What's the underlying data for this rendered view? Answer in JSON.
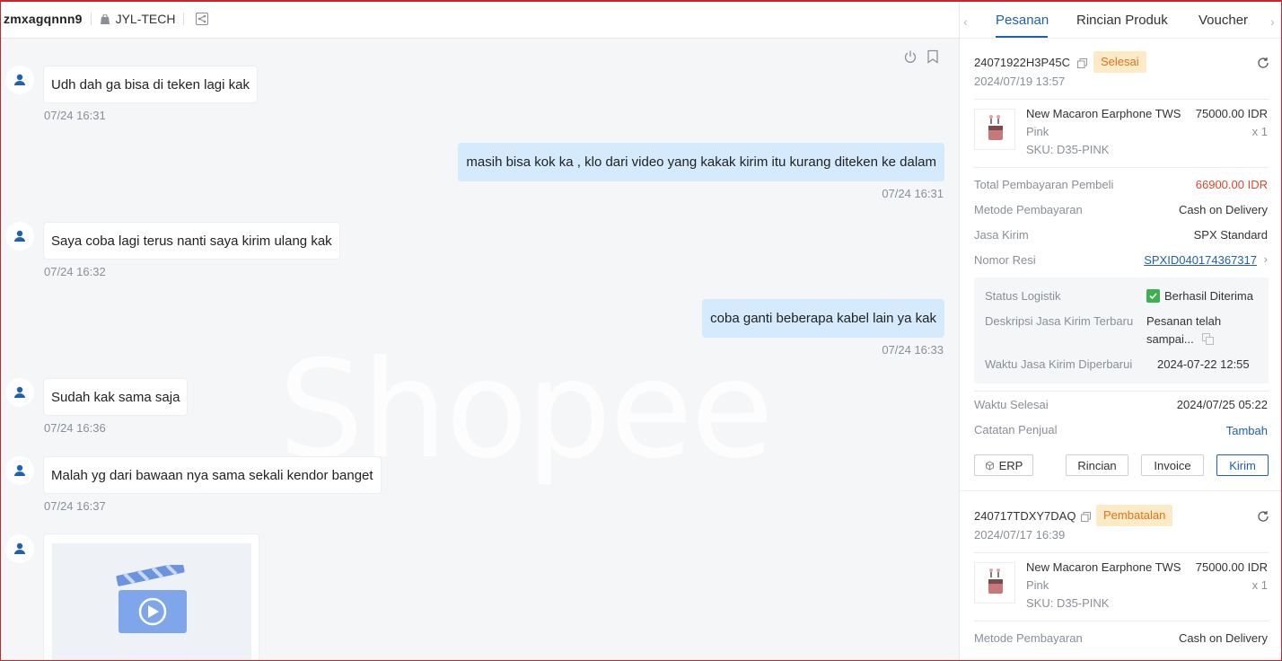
{
  "header": {
    "username": "zmxagqnnn9",
    "shop_name": "JYL-TECH"
  },
  "watermark": "Shopee",
  "messages": [
    {
      "side": "in",
      "text": "Udh dah ga bisa di teken lagi kak",
      "time": "07/24 16:31"
    },
    {
      "side": "out",
      "text": "masih bisa kok ka , klo dari video yang kakak kirim itu kurang diteken ke dalam",
      "time": "07/24 16:31"
    },
    {
      "side": "in",
      "text": "Saya coba lagi terus nanti saya kirim ulang kak",
      "time": "07/24 16:32"
    },
    {
      "side": "out",
      "text": "coba ganti beberapa kabel lain ya kak",
      "time": "07/24 16:33"
    },
    {
      "side": "in",
      "text": "Sudah kak sama saja",
      "time": "07/24 16:36"
    },
    {
      "side": "in",
      "text": "Malah yg dari bawaan nya sama sekali kendor banget",
      "time": "07/24 16:37"
    }
  ],
  "tabs": [
    "Pesanan",
    "Rincian Produk",
    "Voucher"
  ],
  "orders": [
    {
      "id": "24071922H3P45C",
      "status": "Selesai",
      "date": "2024/07/19 13:57",
      "product": {
        "name": "New Macaron Earphone TWS",
        "variant": "Pink",
        "sku": "SKU: D35-PINK",
        "price": "75000.00 IDR",
        "qty": "x 1"
      },
      "rows": {
        "total_label": "Total Pembayaran Pembeli",
        "total_value": "66900.00 IDR",
        "method_label": "Metode Pembayaran",
        "method_value": "Cash on Delivery",
        "courier_label": "Jasa Kirim",
        "courier_value": "SPX Standard",
        "resi_label": "Nomor Resi",
        "resi_value": "SPXID040174367317"
      },
      "logistics": {
        "status_label": "Status Logistik",
        "status_value": "Berhasil Diterima",
        "desc_label": "Deskripsi Jasa Kirim Terbaru",
        "desc_value_1": "Pesanan telah",
        "desc_value_2": "sampai...",
        "updated_label": "Waktu Jasa Kirim Diperbarui",
        "updated_value": "2024-07-22 12:55"
      },
      "finish_label": "Waktu Selesai",
      "finish_value": "2024/07/25 05:22",
      "note_label": "Catatan Penjual",
      "note_action": "Tambah",
      "buttons": {
        "erp": "ERP",
        "detail": "Rincian",
        "invoice": "Invoice",
        "send": "Kirim"
      }
    },
    {
      "id": "240717TDXY7DAQ",
      "status": "Pembatalan",
      "date": "2024/07/17 16:39",
      "product": {
        "name": "New Macaron Earphone TWS",
        "variant": "Pink",
        "sku": "SKU: D35-PINK",
        "price": "75000.00 IDR",
        "qty": "x 1"
      },
      "rows": {
        "method_label": "Metode Pembayaran",
        "method_value": "Cash on Delivery"
      }
    }
  ]
}
